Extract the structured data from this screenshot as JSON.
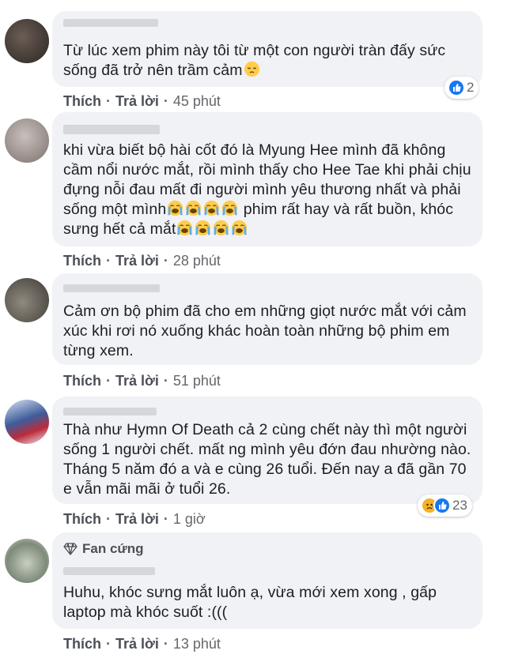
{
  "actions": {
    "like": "Thích",
    "reply": "Trả lời",
    "separator": "·"
  },
  "comments": [
    {
      "text": "Từ lúc xem phim này tôi từ một con người tràn đấy sức\nsống đã trở nên trầm cảm",
      "emoji": "pensive-face",
      "time": "45 phút",
      "reaction_count": "2",
      "reactions": [
        "like"
      ]
    },
    {
      "text_line1": "khi vừa biết bộ hài cốt đó là Myung Hee mình đã không",
      "text_line2": "cầm nổi nước mắt, rồi mình thấy cho Hee Tae khi phải chịu",
      "text_line3": "đựng nỗi đau mất đi người mình yêu thương nhất và phải",
      "text_line4a": "sống một mình",
      "text_line4b": " phim rất hay và rất buồn, khóc",
      "text_line5": "sưng hết cả mắt",
      "emoji": "loudly-crying-face",
      "time": "28 phút"
    },
    {
      "text": "Cảm ơn bộ phim đã cho em những giọt nước mắt với cảm\nxúc khi rơi nó xuống khác hoàn toàn những bộ phim em\ntừng xem.",
      "time": "51 phút"
    },
    {
      "text": "Thà như Hymn Of Death cả 2 cùng chết này thì một người\nsống 1 người chết. mất ng mình yêu đớn đau nhường nào.\nTháng 5 năm đó a và e cùng 26 tuổi. Đến nay a đã gần 70\ne vẫn mãi mãi ở tuổi 26.",
      "time": "1 giờ",
      "reaction_count": "23",
      "reactions": [
        "sad",
        "like"
      ]
    },
    {
      "badge": "Fan cứng",
      "text": "Huhu, khóc sưng mắt luôn ạ, vừa mới xem xong , gấp\nlaptop mà khóc suốt :(((",
      "time": "13 phút"
    }
  ]
}
